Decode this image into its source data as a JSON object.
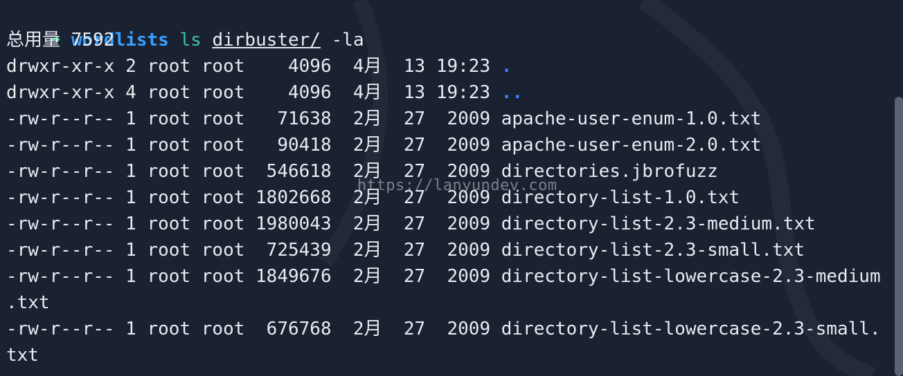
{
  "prompt": {
    "arrow": "➜",
    "dir": "wordlists",
    "cmd": "ls",
    "arg": "dirbuster/",
    "flags": "-la"
  },
  "total": "总用量 7592",
  "rows": [
    "drwxr-xr-x 2 root root    4096  4月  13 19:23 ",
    "drwxr-xr-x 4 root root    4096  4月  13 19:23 ",
    "-rw-r--r-- 1 root root   71638  2月  27  2009 apache-user-enum-1.0.txt",
    "-rw-r--r-- 1 root root   90418  2月  27  2009 apache-user-enum-2.0.txt",
    "-rw-r--r-- 1 root root  546618  2月  27  2009 directories.jbrofuzz",
    "-rw-r--r-- 1 root root 1802668  2月  27  2009 directory-list-1.0.txt",
    "-rw-r--r-- 1 root root 1980043  2月  27  2009 directory-list-2.3-medium.txt",
    "-rw-r--r-- 1 root root  725439  2月  27  2009 directory-list-2.3-small.txt",
    "-rw-r--r-- 1 root root 1849676  2月  27  2009 directory-list-lowercase-2.3-medium",
    ".txt",
    "-rw-r--r-- 1 root root  676768  2月  27  2009 directory-list-lowercase-2.3-small.",
    "txt"
  ],
  "dir_entries": [
    ".",
    ".."
  ],
  "watermark": "https://lanyundev.com",
  "colors": {
    "background": "#1a2130",
    "prompt_arrow": "#35d38b",
    "dir": "#3b82f6",
    "command": "#3fc1b3"
  }
}
